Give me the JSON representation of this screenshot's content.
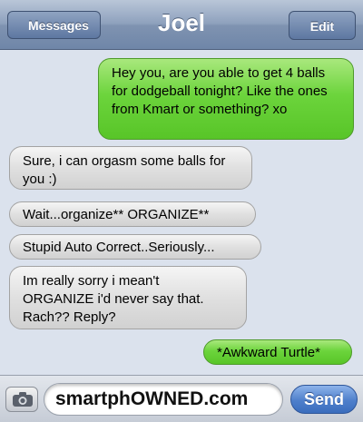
{
  "header": {
    "title": "Joel",
    "back_label": "Messages",
    "edit_label": "Edit"
  },
  "messages": [
    {
      "direction": "sent",
      "text": "Hey you, are you able to get 4 balls for dodgeball tonight? Like the ones from Kmart or something? xo"
    },
    {
      "direction": "received",
      "text": "Sure, i can orgasm some balls for you :)"
    },
    {
      "direction": "received",
      "text": "Wait...organize** ORGANIZE**"
    },
    {
      "direction": "received",
      "text": "Stupid Auto Correct..Seriously..."
    },
    {
      "direction": "received",
      "text": "Im really sorry i mean't ORGANIZE i'd never say that. Rach?? Reply?"
    },
    {
      "direction": "sent",
      "text": "*Awkward Turtle*"
    }
  ],
  "compose": {
    "value": "smartphOWNED.com",
    "send_label": "Send",
    "camera_icon": "camera-icon"
  },
  "colors": {
    "sent_bubble": "#6cd43c",
    "received_bubble": "#e0e0e0",
    "send_button": "#4e7fcb"
  }
}
